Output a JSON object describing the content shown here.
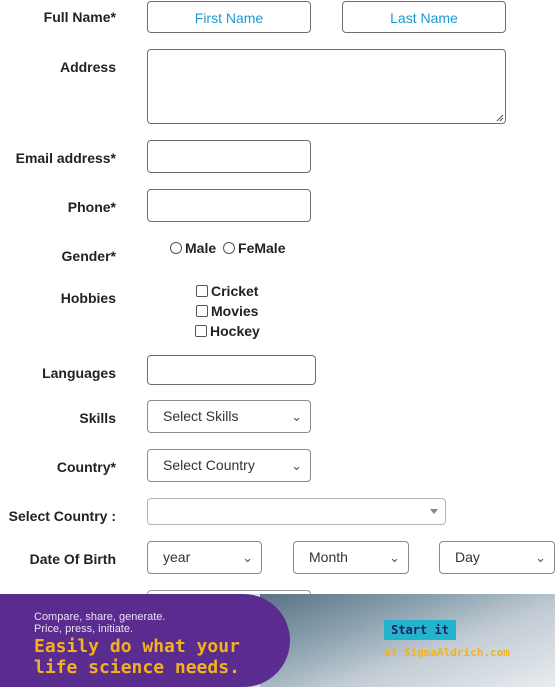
{
  "form": {
    "full_name": {
      "label": "Full Name*",
      "first_placeholder": "First Name",
      "last_placeholder": "Last Name"
    },
    "address": {
      "label": "Address"
    },
    "email": {
      "label": "Email address*"
    },
    "phone": {
      "label": "Phone*"
    },
    "gender": {
      "label": "Gender*",
      "options": [
        "Male",
        "FeMale"
      ]
    },
    "hobbies": {
      "label": "Hobbies",
      "options": [
        "Cricket",
        "Movies",
        "Hockey"
      ]
    },
    "languages": {
      "label": "Languages"
    },
    "skills": {
      "label": "Skills",
      "selected": "Select Skills"
    },
    "country": {
      "label": "Country*",
      "selected": "Select Country"
    },
    "select_country": {
      "label": "Select Country :"
    },
    "dob": {
      "label": "Date Of Birth",
      "year": "year",
      "month": "Month",
      "day": "Day"
    }
  },
  "ad": {
    "line1": "Compare, share, generate.",
    "line2": "Price, press, initiate.",
    "headline1": "Easily do what your",
    "headline2": "life science needs.",
    "cta": "Start it",
    "site": "at SigmaAldrich.com"
  },
  "colors": {
    "placeholder": "#1a9ad6",
    "ad_purple": "#5b2c8f",
    "ad_accent": "#f3b21b",
    "ad_cta": "#21b4cc"
  }
}
